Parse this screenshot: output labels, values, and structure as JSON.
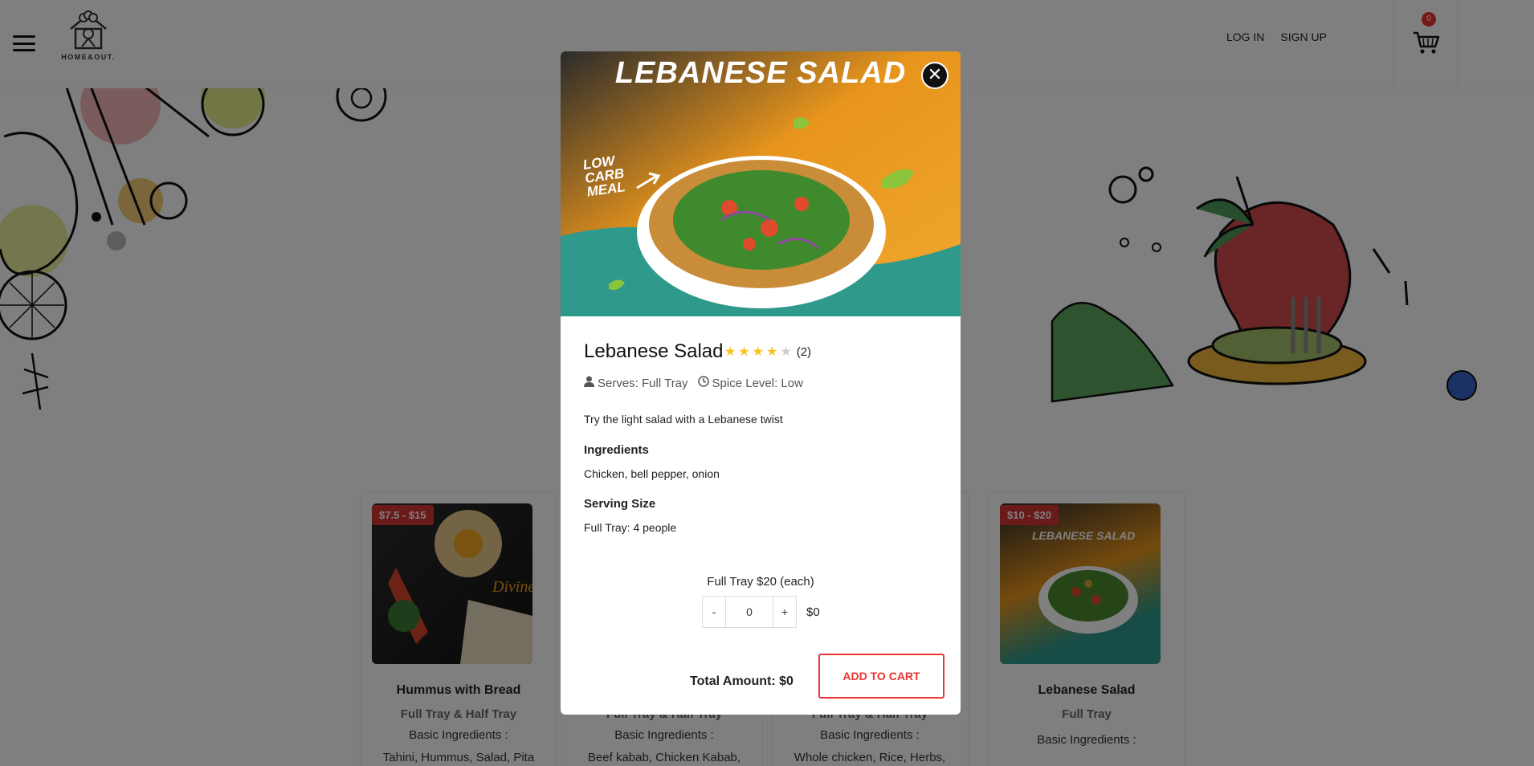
{
  "header": {
    "logo_text": "HOME&OUT.",
    "login": "LOG IN",
    "signup": "SIGN UP",
    "cart_count": "0"
  },
  "cards": [
    {
      "price": "$7.5 - $15",
      "title": "Hummus with Bread",
      "subtitle": "Full Tray & Half Tray",
      "ingredients_label": "Basic Ingredients :",
      "ingredients": "Tahini, Hummus, Salad, Pita"
    },
    {
      "price": "",
      "title": "",
      "subtitle": "Full Tray & Half Tray",
      "ingredients_label": "Basic Ingredients :",
      "ingredients": "Beef kabab, Chicken Kabab,"
    },
    {
      "price": "",
      "title": "",
      "subtitle": "Full Tray & Half Tray",
      "ingredients_label": "Basic Ingredients :",
      "ingredients": "Whole chicken, Rice, Herbs,"
    },
    {
      "price": "$10 - $20",
      "title": "Lebanese Salad",
      "subtitle": "Full Tray",
      "ingredients_label": "Basic Ingredients :",
      "ingredients": ""
    }
  ],
  "modal": {
    "banner_title": "LEBANESE SALAD",
    "banner_note": "LOW CARB MEAL",
    "title": "Lebanese Salad",
    "rating": 4,
    "rating_count": "(2)",
    "serves": "Serves: Full Tray",
    "spice": "Spice Level: Low",
    "description": "Try the light salad with a Lebanese twist",
    "ingredients_heading": "Ingredients",
    "ingredients": "Chicken, bell pepper, onion",
    "serving_heading": "Serving Size",
    "serving": "Full Tray: 4 people",
    "tray_label": "Full Tray $20 (each)",
    "qty": "0",
    "minus": "-",
    "plus": "+",
    "line_price": "$0",
    "total": "Total Amount: $0",
    "add_to_cart": "ADD TO CART",
    "close": "✕"
  },
  "colors": {
    "accent_red": "#e33333",
    "price_tag": "#d73434",
    "star": "#f5c518",
    "banner_orange": "#e8951c",
    "banner_teal": "#2f9a8c"
  }
}
